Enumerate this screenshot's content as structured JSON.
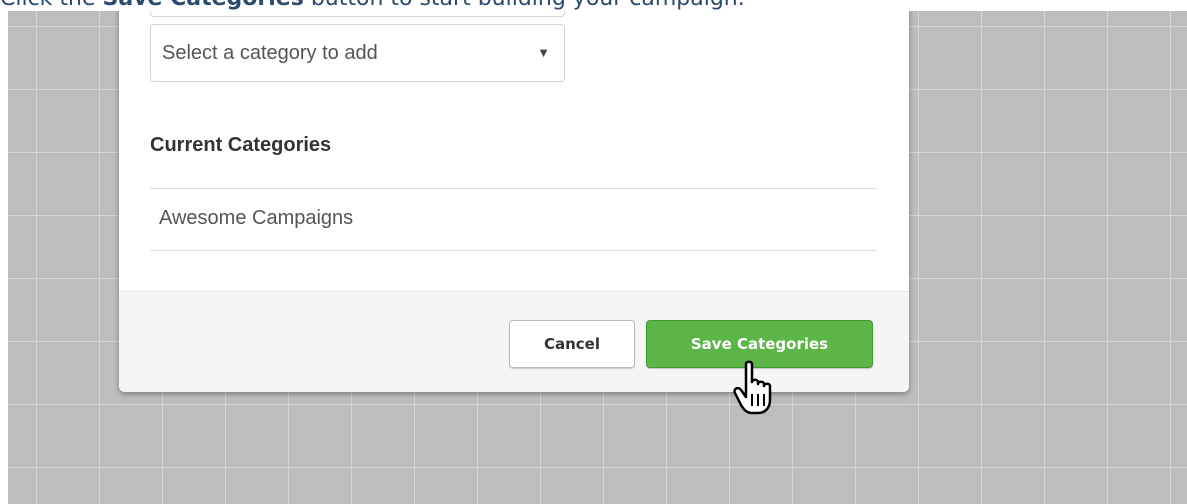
{
  "instruction": {
    "prefix": "Click the ",
    "bold": "Save Categories",
    "suffix": " button to start building your campaign."
  },
  "modal": {
    "category_select": {
      "value": "Select a category to add",
      "arrow": "▼"
    },
    "current_categories": {
      "title": "Current Categories",
      "items": [
        "Awesome Campaigns"
      ]
    },
    "footer": {
      "cancel_label": "Cancel",
      "save_label": "Save Categories"
    }
  },
  "cursor": {
    "icon": "pointer-hand-icon"
  },
  "colors": {
    "save_button": "#5cb547",
    "background_grid": "#bdbdbd",
    "instruction_text": "#2c4a6e"
  }
}
